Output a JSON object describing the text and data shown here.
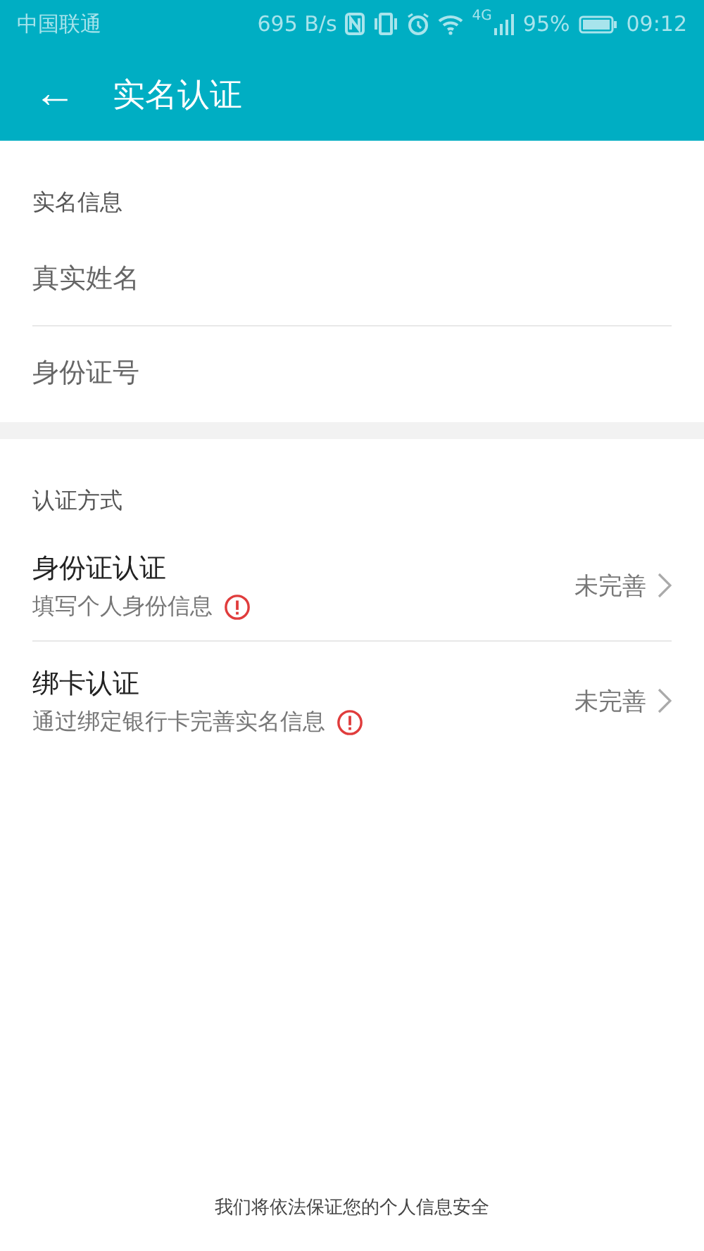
{
  "status_bar": {
    "carrier": "中国联通",
    "speed": "695 B/s",
    "network": "4G",
    "battery": "95%",
    "time": "09:12"
  },
  "app_bar": {
    "back": "←",
    "title": "实名认证"
  },
  "info_section": {
    "title": "实名信息",
    "fields": [
      {
        "placeholder": "真实姓名"
      },
      {
        "placeholder": "身份证号"
      }
    ]
  },
  "method_section": {
    "title": "认证方式",
    "items": [
      {
        "title": "身份证认证",
        "subtitle": "填写个人身份信息",
        "status": "未完善"
      },
      {
        "title": "绑卡认证",
        "subtitle": "通过绑定银行卡完善实名信息",
        "status": "未完善"
      }
    ]
  },
  "footer": "我们将依法保证您的个人信息安全"
}
